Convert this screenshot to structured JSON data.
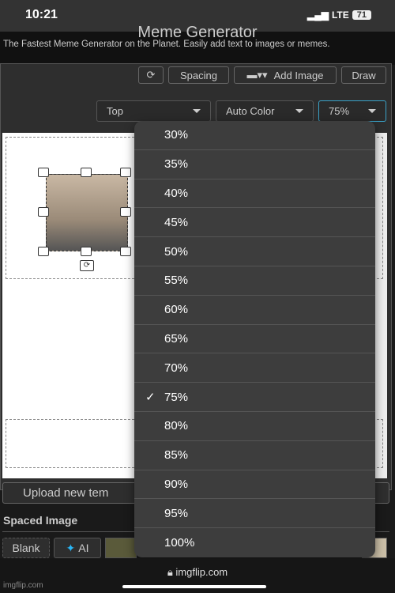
{
  "status": {
    "time": "10:21",
    "network": "LTE",
    "battery": "71"
  },
  "header": {
    "title": "Meme Generator",
    "subtitle": "The Fastest Meme Generator on the Planet. Easily add text to images or memes."
  },
  "toolbar": {
    "rotate_icon": "rotate-icon",
    "spacing": "Spacing",
    "add_image": "Add Image",
    "draw": "Draw"
  },
  "selects": {
    "position": "Top",
    "color": "Auto Color",
    "opacity": "75%"
  },
  "dropdown": {
    "options": [
      "30%",
      "35%",
      "40%",
      "45%",
      "50%",
      "55%",
      "60%",
      "65%",
      "70%",
      "75%",
      "80%",
      "85%",
      "90%",
      "95%",
      "100%"
    ],
    "selected": "75%"
  },
  "upload": "Upload new tem",
  "section": "Spaced Image",
  "templates": {
    "blank": "Blank",
    "ai": "AI"
  },
  "browser": {
    "url": "imgflip.com",
    "watermark": "imgflip.com"
  },
  "colors": {
    "accent": "#3aa3c9",
    "ai": "#29b6f6"
  }
}
